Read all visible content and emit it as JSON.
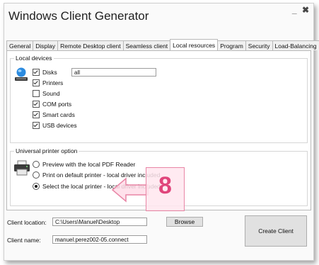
{
  "window": {
    "title": "Windows Client Generator",
    "controls": {
      "minimize": "_",
      "close": "✖"
    }
  },
  "tabs": [
    {
      "label": "General"
    },
    {
      "label": "Display"
    },
    {
      "label": "Remote Desktop client"
    },
    {
      "label": "Seamless client"
    },
    {
      "label": "Local resources",
      "active": true
    },
    {
      "label": "Program"
    },
    {
      "label": "Security"
    },
    {
      "label": "Load-Balancing"
    }
  ],
  "local_devices": {
    "group_label": "Local devices",
    "disks_value": "all",
    "items": [
      {
        "label": "Disks",
        "checked": true
      },
      {
        "label": "Printers",
        "checked": true
      },
      {
        "label": "Sound",
        "checked": false
      },
      {
        "label": "COM ports",
        "checked": true
      },
      {
        "label": "Smart cards",
        "checked": true
      },
      {
        "label": "USB devices",
        "checked": true
      }
    ]
  },
  "printer_option": {
    "group_label": "Universal printer option",
    "options": [
      {
        "label": "Preview with the local PDF Reader",
        "selected": false
      },
      {
        "label": "Print on default printer - local driver included",
        "selected": false
      },
      {
        "label": "Select the local printer - local driver included",
        "selected": true
      }
    ]
  },
  "client_location": {
    "label": "Client location:",
    "value": "C:\\Users\\Manuel\\Desktop"
  },
  "client_name": {
    "label": "Client name:",
    "value": "manuel.perez002-05.connect"
  },
  "browse_button": "Browse",
  "create_button": "Create Client",
  "callout": {
    "number": "8",
    "accent": "#e0457b"
  }
}
